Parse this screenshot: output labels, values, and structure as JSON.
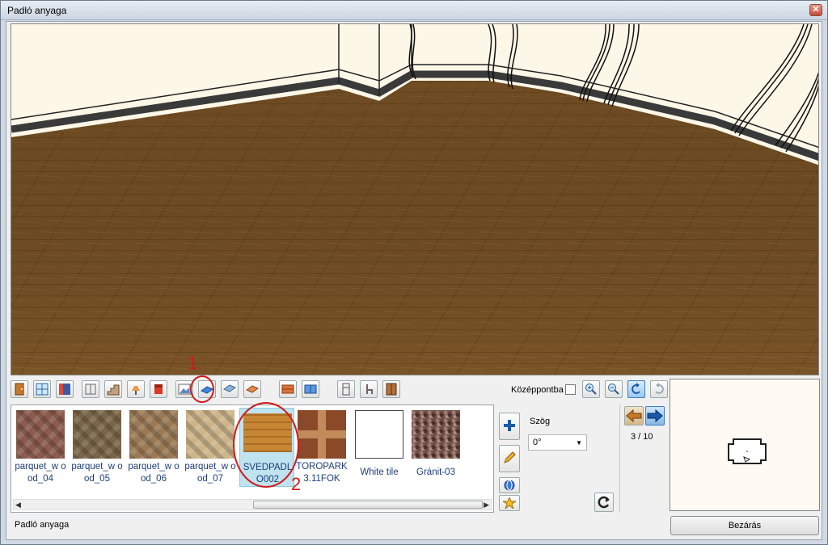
{
  "window": {
    "title": "Padló anyaga",
    "close_glyph": "✕"
  },
  "toolbar": {
    "icons": [
      "door-icon",
      "window-icon",
      "wall-texture-icon",
      "cabinet-icon",
      "stair-icon",
      "lamp-icon",
      "paint-icon",
      "picture-icon",
      "floor-icon",
      "ceiling-icon",
      "roof-icon",
      "brick-icon",
      "tile-icon",
      "fridge-icon",
      "chair-icon",
      "wardrobe-icon"
    ],
    "center_label": "Középpontba"
  },
  "materials": [
    {
      "name": "parquet_wood_04",
      "label": "parquet_w ood_04",
      "color": "#8a5a4c"
    },
    {
      "name": "parquet_wood_05",
      "label": "parquet_w ood_05",
      "color": "#7a6546"
    },
    {
      "name": "parquet_wood_06",
      "label": "parquet_w ood_06",
      "color": "#9b7a55"
    },
    {
      "name": "parquet_wood_07",
      "label": "parquet_w ood_07",
      "color": "#cdb48a"
    },
    {
      "name": "SVEDPADLO002",
      "label": "SVEDPADL O002",
      "color": "#c68634",
      "selected": true
    },
    {
      "name": "TOROPARK 3.11FOK",
      "label": "TOROPARK 3.11FOK",
      "color": "#8a4a2a"
    },
    {
      "name": "White tile",
      "label": "White tile",
      "color": "#ffffff"
    },
    {
      "name": "Gránit-03",
      "label": "Gránit-03",
      "color": "#6f5048"
    }
  ],
  "angle": {
    "label": "Szög",
    "value": "0°"
  },
  "pager": {
    "indicator": "3 / 10"
  },
  "status": {
    "text": "Padló anyaga"
  },
  "buttons": {
    "close": "Bezárás"
  },
  "annotations": {
    "one": "1",
    "two": "2"
  },
  "colors": {
    "floor": "#7a5427",
    "annotation": "#d11a1a"
  }
}
